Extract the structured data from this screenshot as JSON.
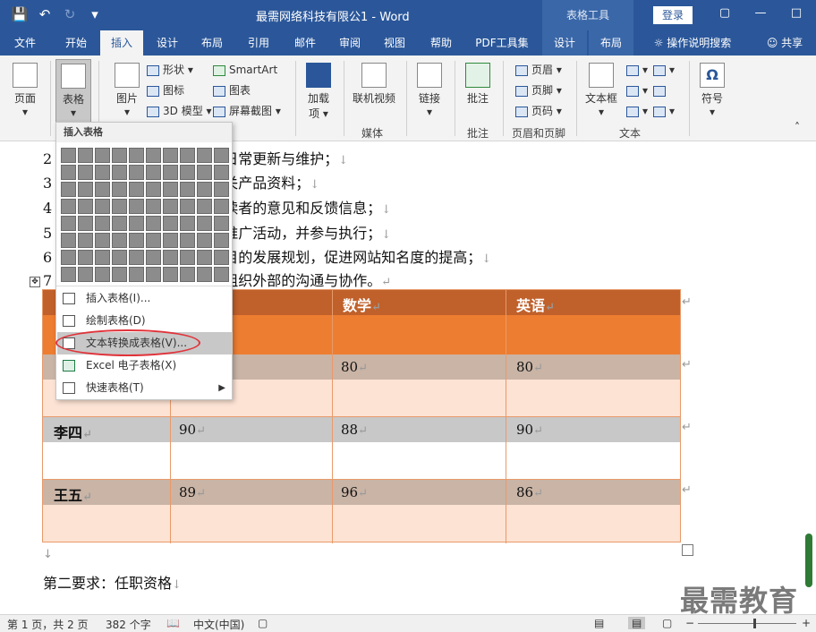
{
  "title_bar": {
    "doc_title": "最需网络科技有限公1 - Word",
    "context_title": "表格工具",
    "login": "登录"
  },
  "tabs": [
    "文件",
    "开始",
    "插入",
    "设计",
    "布局",
    "引用",
    "邮件",
    "审阅",
    "视图",
    "帮助",
    "PDF工具集",
    "设计",
    "布局"
  ],
  "tell_me": "操作说明搜索",
  "share": "共享",
  "ribbon": {
    "page": "页面",
    "table": "表格",
    "picture": "图片",
    "shapes": "形状",
    "icons": "图标",
    "model3d": "3D 模型",
    "smartart": "SmartArt",
    "chart": "图表",
    "screenshot": "屏幕截图",
    "addins": "加载",
    "addins2": "项",
    "online_video": "联机视频",
    "link": "链接",
    "comment": "批注",
    "header": "页眉",
    "footer": "页脚",
    "page_number": "页码",
    "textbox": "文本框",
    "symbol": "符号",
    "group_media": "媒体",
    "group_comment": "批注",
    "group_header_footer": "页眉和页脚",
    "group_text": "文本"
  },
  "doc_lines": [
    {
      "num": "2",
      "text": "日常更新与维护；"
    },
    {
      "num": "3",
      "text": "关产品资料；"
    },
    {
      "num": "4",
      "text": "读者的意见和反馈信息；"
    },
    {
      "num": "5",
      "text": "推广活动，并参与执行；"
    },
    {
      "num": "6",
      "text": "目的发展规划，促进网站知名度的提高；"
    },
    {
      "num": "7",
      "text": "组织外部的沟通与协作。"
    }
  ],
  "table": {
    "headers": [
      "数学",
      "英语"
    ],
    "rows": [
      {
        "name": "",
        "c1": "",
        "c2": "80",
        "c3": "80"
      },
      {
        "name": "李四",
        "c1": "90",
        "c2": "88",
        "c3": "90"
      },
      {
        "name": "王五",
        "c1": "89",
        "c2": "96",
        "c3": "86"
      }
    ]
  },
  "after_table": "第二要求：任职资格",
  "dropdown": {
    "title": "插入表格",
    "items": [
      "插入表格(I)...",
      "绘制表格(D)",
      "文本转换成表格(V)...",
      "Excel 电子表格(X)",
      "快速表格(T)"
    ]
  },
  "status": {
    "page": "第 1 页，共 2 页",
    "words": "382 个字",
    "lang": "中文(中国)"
  },
  "watermark": "最需教育",
  "marks": {
    "para": "↵",
    "down": "↓"
  }
}
